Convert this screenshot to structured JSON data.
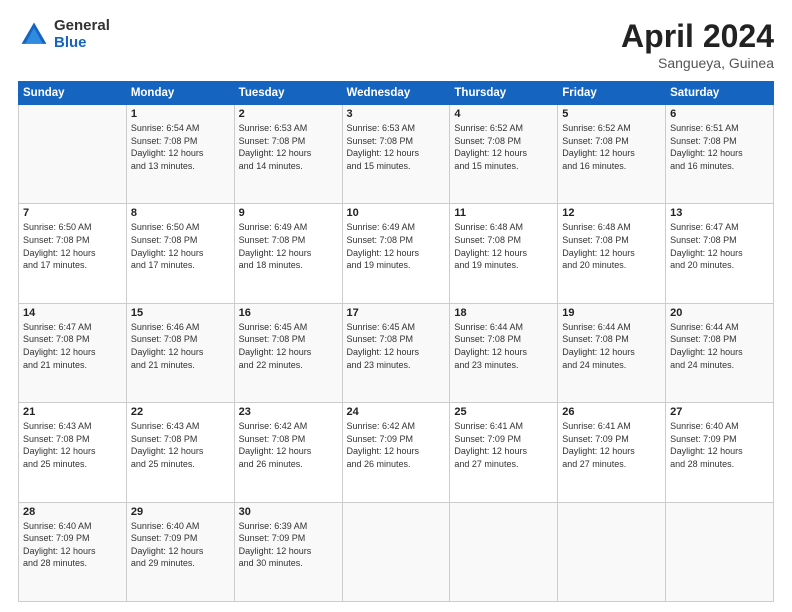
{
  "logo": {
    "general": "General",
    "blue": "Blue"
  },
  "title": {
    "month": "April 2024",
    "location": "Sangueya, Guinea"
  },
  "weekdays": [
    "Sunday",
    "Monday",
    "Tuesday",
    "Wednesday",
    "Thursday",
    "Friday",
    "Saturday"
  ],
  "weeks": [
    [
      {
        "day": "",
        "info": ""
      },
      {
        "day": "1",
        "info": "Sunrise: 6:54 AM\nSunset: 7:08 PM\nDaylight: 12 hours\nand 13 minutes."
      },
      {
        "day": "2",
        "info": "Sunrise: 6:53 AM\nSunset: 7:08 PM\nDaylight: 12 hours\nand 14 minutes."
      },
      {
        "day": "3",
        "info": "Sunrise: 6:53 AM\nSunset: 7:08 PM\nDaylight: 12 hours\nand 15 minutes."
      },
      {
        "day": "4",
        "info": "Sunrise: 6:52 AM\nSunset: 7:08 PM\nDaylight: 12 hours\nand 15 minutes."
      },
      {
        "day": "5",
        "info": "Sunrise: 6:52 AM\nSunset: 7:08 PM\nDaylight: 12 hours\nand 16 minutes."
      },
      {
        "day": "6",
        "info": "Sunrise: 6:51 AM\nSunset: 7:08 PM\nDaylight: 12 hours\nand 16 minutes."
      }
    ],
    [
      {
        "day": "7",
        "info": "Sunrise: 6:50 AM\nSunset: 7:08 PM\nDaylight: 12 hours\nand 17 minutes."
      },
      {
        "day": "8",
        "info": "Sunrise: 6:50 AM\nSunset: 7:08 PM\nDaylight: 12 hours\nand 17 minutes."
      },
      {
        "day": "9",
        "info": "Sunrise: 6:49 AM\nSunset: 7:08 PM\nDaylight: 12 hours\nand 18 minutes."
      },
      {
        "day": "10",
        "info": "Sunrise: 6:49 AM\nSunset: 7:08 PM\nDaylight: 12 hours\nand 19 minutes."
      },
      {
        "day": "11",
        "info": "Sunrise: 6:48 AM\nSunset: 7:08 PM\nDaylight: 12 hours\nand 19 minutes."
      },
      {
        "day": "12",
        "info": "Sunrise: 6:48 AM\nSunset: 7:08 PM\nDaylight: 12 hours\nand 20 minutes."
      },
      {
        "day": "13",
        "info": "Sunrise: 6:47 AM\nSunset: 7:08 PM\nDaylight: 12 hours\nand 20 minutes."
      }
    ],
    [
      {
        "day": "14",
        "info": "Sunrise: 6:47 AM\nSunset: 7:08 PM\nDaylight: 12 hours\nand 21 minutes."
      },
      {
        "day": "15",
        "info": "Sunrise: 6:46 AM\nSunset: 7:08 PM\nDaylight: 12 hours\nand 21 minutes."
      },
      {
        "day": "16",
        "info": "Sunrise: 6:45 AM\nSunset: 7:08 PM\nDaylight: 12 hours\nand 22 minutes."
      },
      {
        "day": "17",
        "info": "Sunrise: 6:45 AM\nSunset: 7:08 PM\nDaylight: 12 hours\nand 23 minutes."
      },
      {
        "day": "18",
        "info": "Sunrise: 6:44 AM\nSunset: 7:08 PM\nDaylight: 12 hours\nand 23 minutes."
      },
      {
        "day": "19",
        "info": "Sunrise: 6:44 AM\nSunset: 7:08 PM\nDaylight: 12 hours\nand 24 minutes."
      },
      {
        "day": "20",
        "info": "Sunrise: 6:44 AM\nSunset: 7:08 PM\nDaylight: 12 hours\nand 24 minutes."
      }
    ],
    [
      {
        "day": "21",
        "info": "Sunrise: 6:43 AM\nSunset: 7:08 PM\nDaylight: 12 hours\nand 25 minutes."
      },
      {
        "day": "22",
        "info": "Sunrise: 6:43 AM\nSunset: 7:08 PM\nDaylight: 12 hours\nand 25 minutes."
      },
      {
        "day": "23",
        "info": "Sunrise: 6:42 AM\nSunset: 7:08 PM\nDaylight: 12 hours\nand 26 minutes."
      },
      {
        "day": "24",
        "info": "Sunrise: 6:42 AM\nSunset: 7:09 PM\nDaylight: 12 hours\nand 26 minutes."
      },
      {
        "day": "25",
        "info": "Sunrise: 6:41 AM\nSunset: 7:09 PM\nDaylight: 12 hours\nand 27 minutes."
      },
      {
        "day": "26",
        "info": "Sunrise: 6:41 AM\nSunset: 7:09 PM\nDaylight: 12 hours\nand 27 minutes."
      },
      {
        "day": "27",
        "info": "Sunrise: 6:40 AM\nSunset: 7:09 PM\nDaylight: 12 hours\nand 28 minutes."
      }
    ],
    [
      {
        "day": "28",
        "info": "Sunrise: 6:40 AM\nSunset: 7:09 PM\nDaylight: 12 hours\nand 28 minutes."
      },
      {
        "day": "29",
        "info": "Sunrise: 6:40 AM\nSunset: 7:09 PM\nDaylight: 12 hours\nand 29 minutes."
      },
      {
        "day": "30",
        "info": "Sunrise: 6:39 AM\nSunset: 7:09 PM\nDaylight: 12 hours\nand 30 minutes."
      },
      {
        "day": "",
        "info": ""
      },
      {
        "day": "",
        "info": ""
      },
      {
        "day": "",
        "info": ""
      },
      {
        "day": "",
        "info": ""
      }
    ]
  ]
}
